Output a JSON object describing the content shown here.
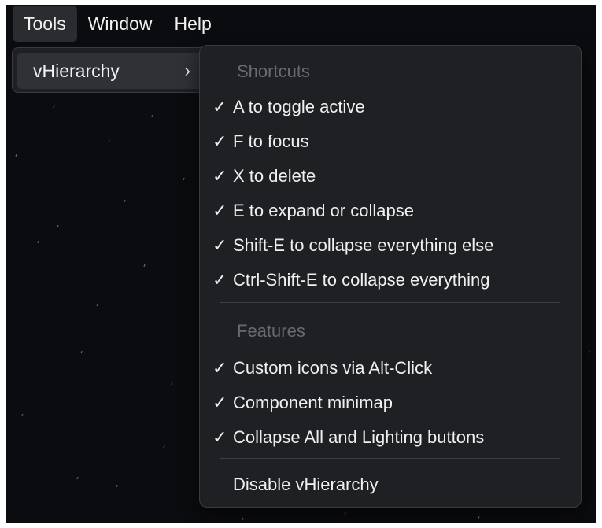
{
  "menubar": {
    "items": [
      "Tools",
      "Window",
      "Help"
    ],
    "active": "Tools"
  },
  "tools_menu": {
    "item_label": "vHierarchy",
    "chevron": "›"
  },
  "vhierarchy_menu": {
    "sections": [
      {
        "header": "Shortcuts",
        "items": [
          {
            "label": "A to toggle active",
            "checked": true
          },
          {
            "label": "F to focus",
            "checked": true
          },
          {
            "label": "X to delete",
            "checked": true
          },
          {
            "label": "E to expand or collapse",
            "checked": true
          },
          {
            "label": "Shift-E to collapse everything else",
            "checked": true
          },
          {
            "label": "Ctrl-Shift-E to collapse everything",
            "checked": true
          }
        ]
      },
      {
        "header": "Features",
        "items": [
          {
            "label": "Custom icons via Alt-Click",
            "checked": true
          },
          {
            "label": "Component minimap",
            "checked": true
          },
          {
            "label": "Collapse All and Lighting buttons",
            "checked": true
          }
        ]
      }
    ],
    "disable_label": "Disable vHierarchy",
    "checkmark": "✓"
  },
  "colors": {
    "background": "#0b0c0f",
    "menu_bg": "#1f2024",
    "highlight": "#303136",
    "text": "#f0f0f0",
    "muted_text": "#6a6b70"
  }
}
